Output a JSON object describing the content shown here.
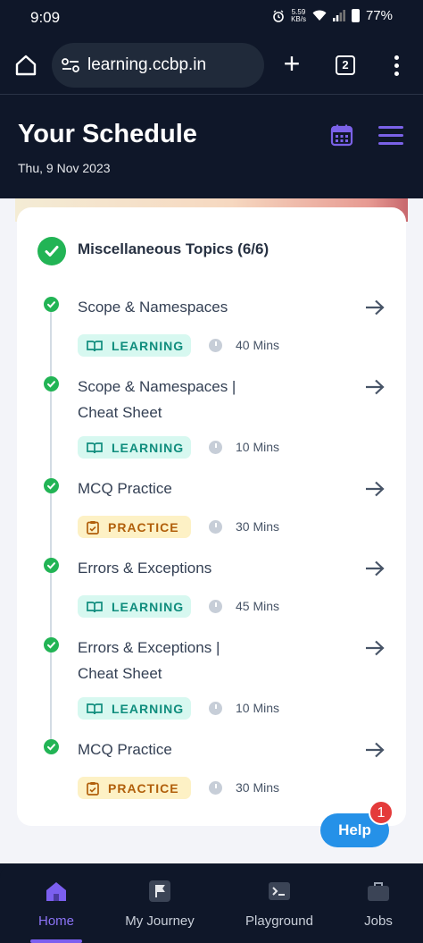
{
  "status_bar": {
    "time": "9:09",
    "net_speed_top": "5.59",
    "net_speed_bottom": "KB/s",
    "battery": "77%"
  },
  "browser": {
    "url": "learning.ccbp.in",
    "tab_count": "2"
  },
  "header": {
    "title": "Your Schedule",
    "date": "Thu, 9 Nov 2023",
    "accent": "#7b62e8"
  },
  "section": {
    "title": "Miscellaneous Topics (6/6)"
  },
  "items": [
    {
      "title": "Scope & Namespaces",
      "type": "LEARNING",
      "duration": "40 Mins"
    },
    {
      "title": "Scope & Namespaces | Cheat Sheet",
      "type": "LEARNING",
      "duration": "10 Mins"
    },
    {
      "title": "MCQ Practice",
      "type": "PRACTICE",
      "duration": "30 Mins"
    },
    {
      "title": "Errors & Exceptions",
      "type": "LEARNING",
      "duration": "45 Mins"
    },
    {
      "title": "Errors & Exceptions | Cheat Sheet",
      "type": "LEARNING",
      "duration": "10 Mins"
    },
    {
      "title": "MCQ Practice",
      "type": "PRACTICE",
      "duration": "30 Mins"
    }
  ],
  "help": {
    "label": "Help",
    "count": "1"
  },
  "nav": [
    {
      "label": "Home",
      "active": true
    },
    {
      "label": "My Journey",
      "active": false
    },
    {
      "label": "Playground",
      "active": false
    },
    {
      "label": "Jobs",
      "active": false
    }
  ],
  "colors": {
    "success": "#22b455",
    "learning_bg": "#d7f8f0",
    "practice_bg": "#fdf1c5",
    "help": "#2591e8"
  }
}
